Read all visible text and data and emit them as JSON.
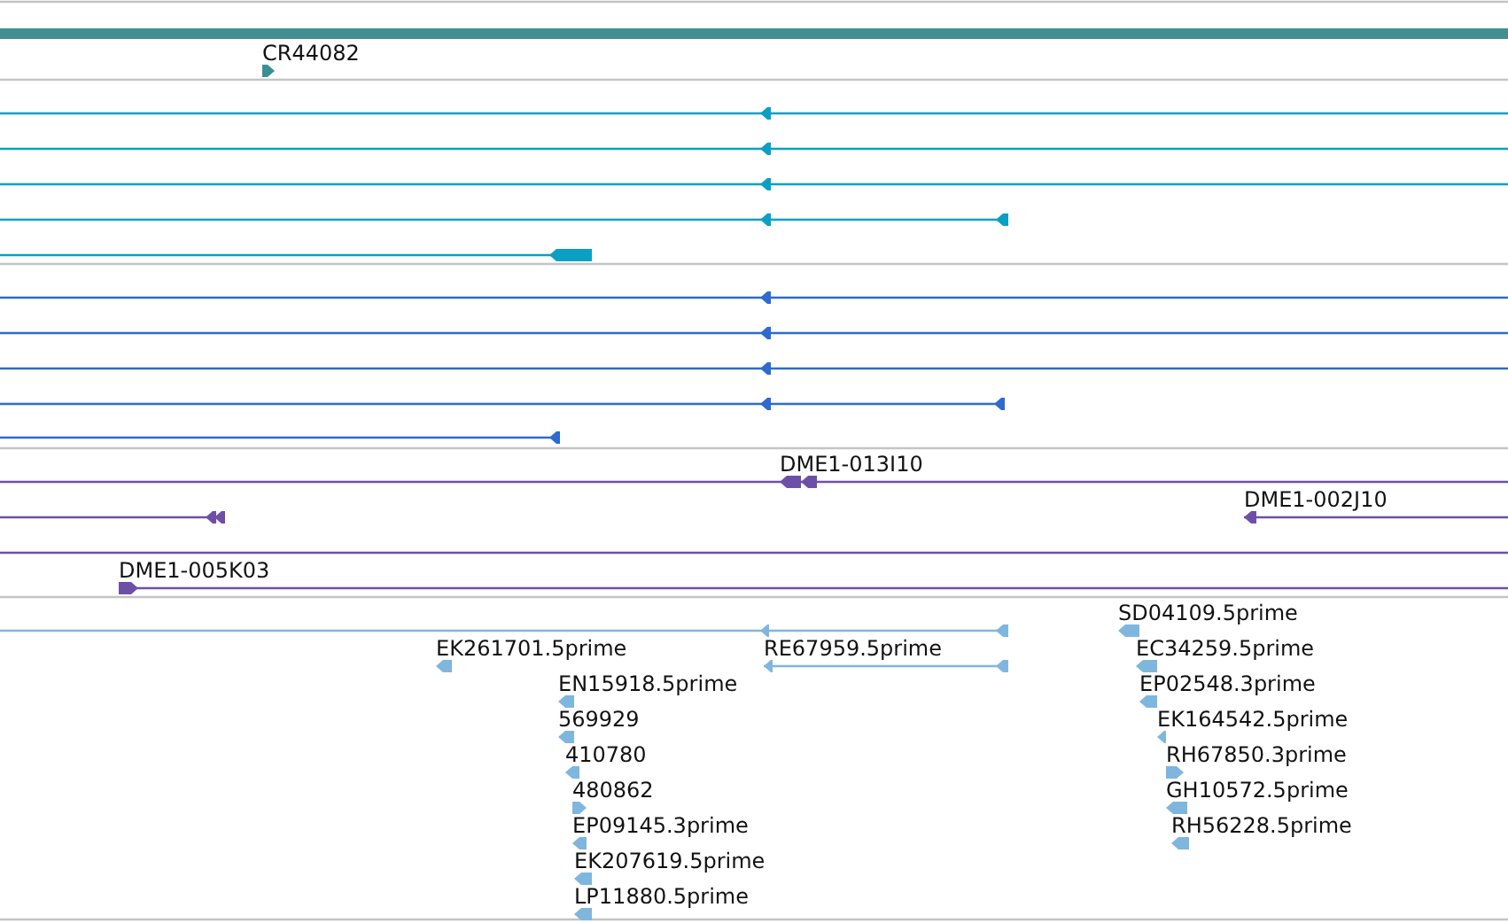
{
  "tracks": [
    {
      "color": "#3a8f94",
      "features": [
        {
          "label": "CR44082",
          "reverse": false
        }
      ]
    },
    {
      "color": "#0aa0c4",
      "features": [
        {
          "reverse": true
        },
        {
          "reverse": true
        },
        {
          "reverse": true
        },
        {
          "reverse": true
        },
        {
          "reverse": true
        }
      ]
    },
    {
      "color": "#2e6ad0",
      "features": [
        {
          "reverse": true
        },
        {
          "reverse": true
        },
        {
          "reverse": true
        },
        {
          "reverse": true
        },
        {
          "reverse": true
        }
      ]
    },
    {
      "color": "#6e4fa8",
      "features": [
        {
          "kind": "arrow",
          "label": "DME1-013I10",
          "reverse": true
        },
        {
          "kind": "arrow",
          "reverse": true
        },
        {
          "kind": "arrow",
          "label": "DME1-002J10",
          "reverse": true
        },
        {
          "kind": "span"
        },
        {
          "kind": "arrow",
          "label": "DME1-005K03",
          "reverse": false
        }
      ]
    },
    {
      "color": "#7fb6de",
      "features": [
        {
          "reverse": true
        },
        {
          "label": "SD04109.5prime",
          "reverse": true
        },
        {
          "label": "EK261701.5prime",
          "reverse": true
        },
        {
          "label": "RE67959.5prime",
          "reverse": true
        },
        {
          "label": "EC34259.5prime",
          "reverse": true
        },
        {
          "label": "EN15918.5prime",
          "reverse": true
        },
        {
          "label": "EP02548.3prime",
          "reverse": true
        },
        {
          "label": "569929",
          "reverse": true
        },
        {
          "label": "EK164542.5prime",
          "reverse": true
        },
        {
          "label": "410780",
          "reverse": true
        },
        {
          "label": "RH67850.3prime",
          "reverse": false
        },
        {
          "label": "480862",
          "reverse": false
        },
        {
          "label": "GH10572.5prime",
          "reverse": true
        },
        {
          "label": "EP09145.3prime",
          "reverse": true
        },
        {
          "label": "RH56228.5prime",
          "reverse": true
        },
        {
          "label": "EK207619.5prime",
          "reverse": true
        },
        {
          "label": "LP11880.5prime",
          "reverse": true
        }
      ]
    }
  ]
}
